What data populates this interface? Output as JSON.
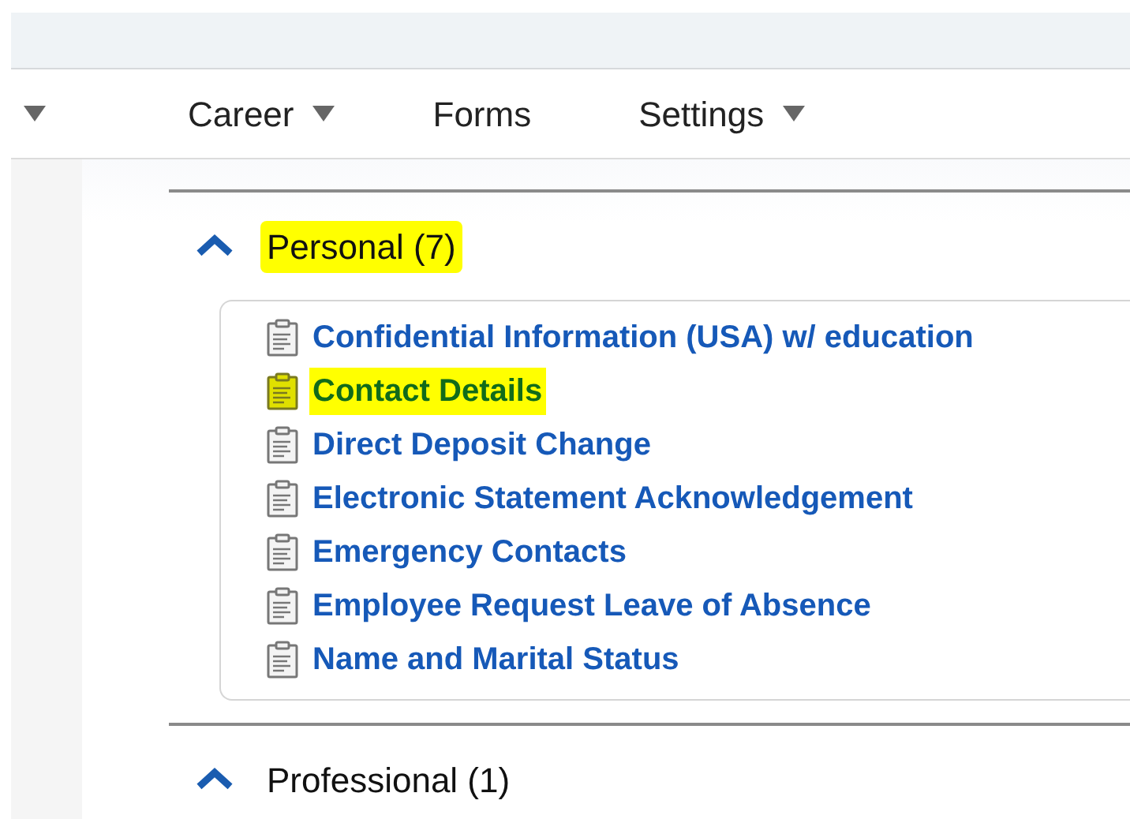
{
  "nav": [
    {
      "dropdown": true
    },
    {
      "label": "Career",
      "dropdown": true
    },
    {
      "label": "Forms",
      "dropdown": false
    },
    {
      "label": "Settings",
      "dropdown": true
    }
  ],
  "sections": [
    {
      "title": "Personal (7)",
      "expanded": true,
      "highlighted": true,
      "forms": [
        {
          "label": "Confidential Information (USA) w/ education",
          "highlighted": false
        },
        {
          "label": "Contact Details",
          "highlighted": true
        },
        {
          "label": "Direct Deposit Change",
          "highlighted": false
        },
        {
          "label": "Electronic Statement Acknowledgement",
          "highlighted": false
        },
        {
          "label": "Emergency Contacts",
          "highlighted": false
        },
        {
          "label": "Employee Request Leave of Absence",
          "highlighted": false
        },
        {
          "label": "Name and Marital Status",
          "highlighted": false
        }
      ]
    },
    {
      "title": "Professional (1)",
      "expanded": true,
      "highlighted": false
    }
  ]
}
